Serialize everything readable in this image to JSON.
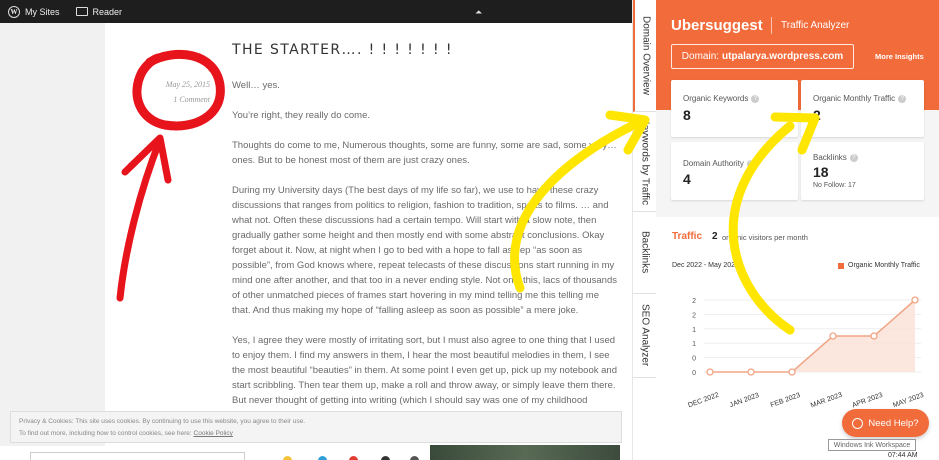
{
  "admin_bar": {
    "my_sites": "My Sites",
    "reader": "Reader"
  },
  "post": {
    "title": "THE STARTER…. ! ! ! ! ! ! !",
    "date": "May 25, 2015",
    "comments": "1 Comment",
    "p1": "Well… yes.",
    "p2": "You’re right, they really do come.",
    "p3": "Thoughts do come to me, Numerous thoughts, some are funny, some are sad, some very… ones. But to be honest most of them are just crazy ones.",
    "p4": "During my University days (The best days of my life so far),  we use to have these crazy discussions that ranges from politics to religion,  fashion to tradition, sports to films. … and what not. Often these discussions had a certain tempo. Will start with a slow note, then gradually gather some height and then mostly end with some abstract conclusions. Okay forget about it. Now, at night when I go to bed with a hope to fall asleep “as soon as possible”, from God knows where, repeat telecasts of these discussions start running in my mind one after another, and that too in a never ending style. Not only this, lacs of thousands of other unmatched pieces of frames start hovering in my mind telling me this telling me that. And thus making my hope of “falling asleep as soon as possible” a mere joke.",
    "p5": "Yes, I agree they were mostly of irritating sort, but I must also agree to one thing that I used to enjoy them. I find my answers in them, I hear the most beautiful melodies in them, I see the most beautiful “beauties” in them. At some point I even get up, pick up my notebook and start scribbling. Then tear them up, make a roll and throw away, or simply leave them there. But never thought of getting into writing (which I should say was one of my childhood dreams as was"
  },
  "cookie": {
    "line1": "Privacy & Cookies: This site uses cookies. By continuing to use this website, you agree to their use.",
    "line2": "To find out more, including how to control cookies, see here:",
    "link": "Cookie Policy"
  },
  "side_tabs": [
    "Domain Overview",
    "Keywords by Traffic",
    "Backlinks",
    "SEO Analyzer"
  ],
  "ubersuggest": {
    "brand": "Ubersuggest",
    "subtitle": "Traffic Analyzer",
    "domain_label": "Domain:",
    "domain": "utpalarya.wordpress.com",
    "more_insights": "More Insights",
    "organic_keywords_label": "Organic Keywords",
    "organic_keywords": "8",
    "organic_traffic_label": "Organic Monthly Traffic",
    "organic_traffic": "2",
    "domain_authority_label": "Domain Authority",
    "domain_authority": "4",
    "backlinks_label": "Backlinks",
    "backlinks": "18",
    "nofollow": "No Follow: 17",
    "traffic_title": "Traffic",
    "traffic_count": "2",
    "traffic_sub": "organic visitors per month",
    "range": "Dec 2022 - May 2023",
    "legend": "Organic Monthly Traffic",
    "help": "Need Help?",
    "accent": "#f26b3a"
  },
  "chart_data": {
    "type": "area",
    "categories": [
      "DEC 2022",
      "JAN 2023",
      "FEB 2023",
      "MAR 2023",
      "APR 2023",
      "MAY 2023"
    ],
    "series": [
      {
        "name": "Organic Monthly Traffic",
        "values": [
          0,
          0,
          0,
          1,
          1,
          2
        ]
      }
    ],
    "y_ticks": [
      "0",
      "0",
      "1",
      "1",
      "2",
      "2"
    ],
    "ylim": [
      0,
      2
    ]
  },
  "windows": {
    "ink": "Windows Ink Workspace",
    "time": "07:44 AM"
  }
}
